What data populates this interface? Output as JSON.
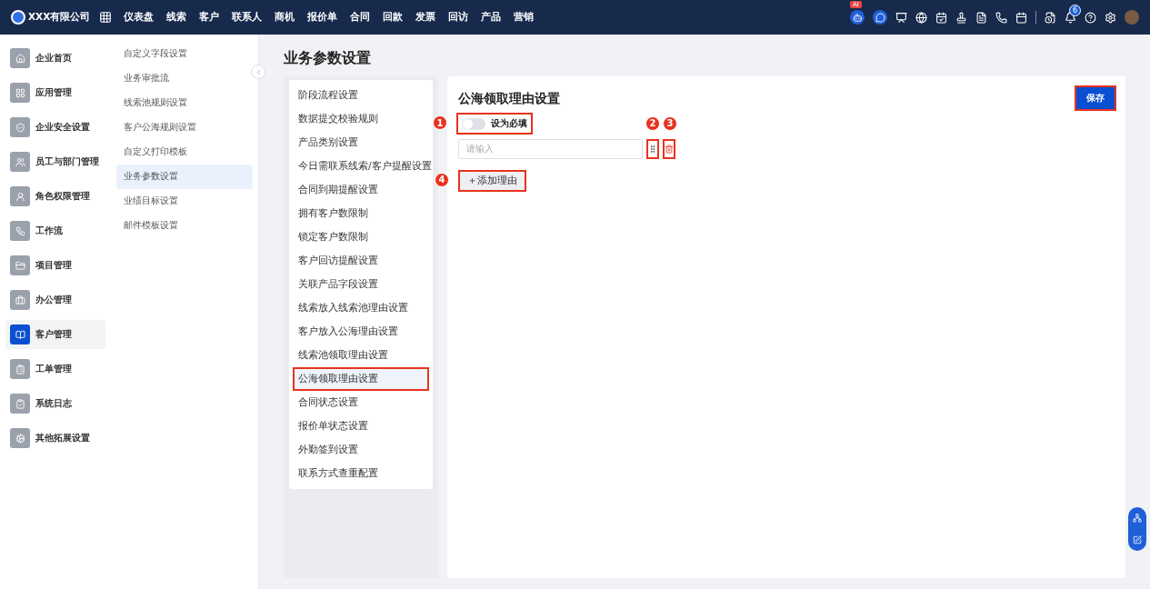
{
  "header": {
    "company": "XXX有限公司",
    "nav": [
      "仪表盘",
      "线索",
      "客户",
      "联系人",
      "商机",
      "报价单",
      "合同",
      "回款",
      "发票",
      "回访",
      "产品",
      "营销"
    ],
    "ai_badge": "AI",
    "notification_count": "6"
  },
  "sidebar": {
    "items": [
      {
        "label": "企业首页",
        "selected": false
      },
      {
        "label": "应用管理",
        "selected": false
      },
      {
        "label": "企业安全设置",
        "selected": false
      },
      {
        "label": "员工与部门管理",
        "selected": false
      },
      {
        "label": "角色权限管理",
        "selected": false
      },
      {
        "label": "工作流",
        "selected": false
      },
      {
        "label": "项目管理",
        "selected": false
      },
      {
        "label": "办公管理",
        "selected": false
      },
      {
        "label": "客户管理",
        "selected": true
      },
      {
        "label": "工单管理",
        "selected": false
      },
      {
        "label": "系统日志",
        "selected": false
      },
      {
        "label": "其他拓展设置",
        "selected": false
      }
    ]
  },
  "submenu": {
    "items": [
      {
        "label": "自定义字段设置",
        "selected": false
      },
      {
        "label": "业务审批流",
        "selected": false
      },
      {
        "label": "线索池规则设置",
        "selected": false
      },
      {
        "label": "客户公海规则设置",
        "selected": false
      },
      {
        "label": "自定义打印模板",
        "selected": false
      },
      {
        "label": "业务参数设置",
        "selected": true
      },
      {
        "label": "业绩目标设置",
        "selected": false
      },
      {
        "label": "邮件模板设置",
        "selected": false
      }
    ]
  },
  "page_title": "业务参数设置",
  "settings_menu": {
    "items": [
      {
        "label": "阶段流程设置",
        "selected": false
      },
      {
        "label": "数据提交校验规则",
        "selected": false
      },
      {
        "label": "产品类别设置",
        "selected": false
      },
      {
        "label": "今日需联系线索/客户提醒设置",
        "selected": false
      },
      {
        "label": "合同到期提醒设置",
        "selected": false
      },
      {
        "label": "拥有客户数限制",
        "selected": false
      },
      {
        "label": "锁定客户数限制",
        "selected": false
      },
      {
        "label": "客户回访提醒设置",
        "selected": false
      },
      {
        "label": "关联产品字段设置",
        "selected": false
      },
      {
        "label": "线索放入线索池理由设置",
        "selected": false
      },
      {
        "label": "客户放入公海理由设置",
        "selected": false
      },
      {
        "label": "线索池领取理由设置",
        "selected": false
      },
      {
        "label": "公海领取理由设置",
        "selected": true
      },
      {
        "label": "合同状态设置",
        "selected": false
      },
      {
        "label": "报价单状态设置",
        "selected": false
      },
      {
        "label": "外勤签到设置",
        "selected": false
      },
      {
        "label": "联系方式查重配置",
        "selected": false
      }
    ]
  },
  "panel": {
    "title": "公海领取理由设置",
    "save_button": "保存",
    "required_toggle": {
      "label": "设为必填",
      "on": false
    },
    "reason_input": {
      "placeholder": "请输入"
    },
    "add_button": "＋添加理由"
  },
  "annotations": {
    "toggle": "1",
    "drag": "2",
    "delete": "3",
    "add": "4"
  }
}
